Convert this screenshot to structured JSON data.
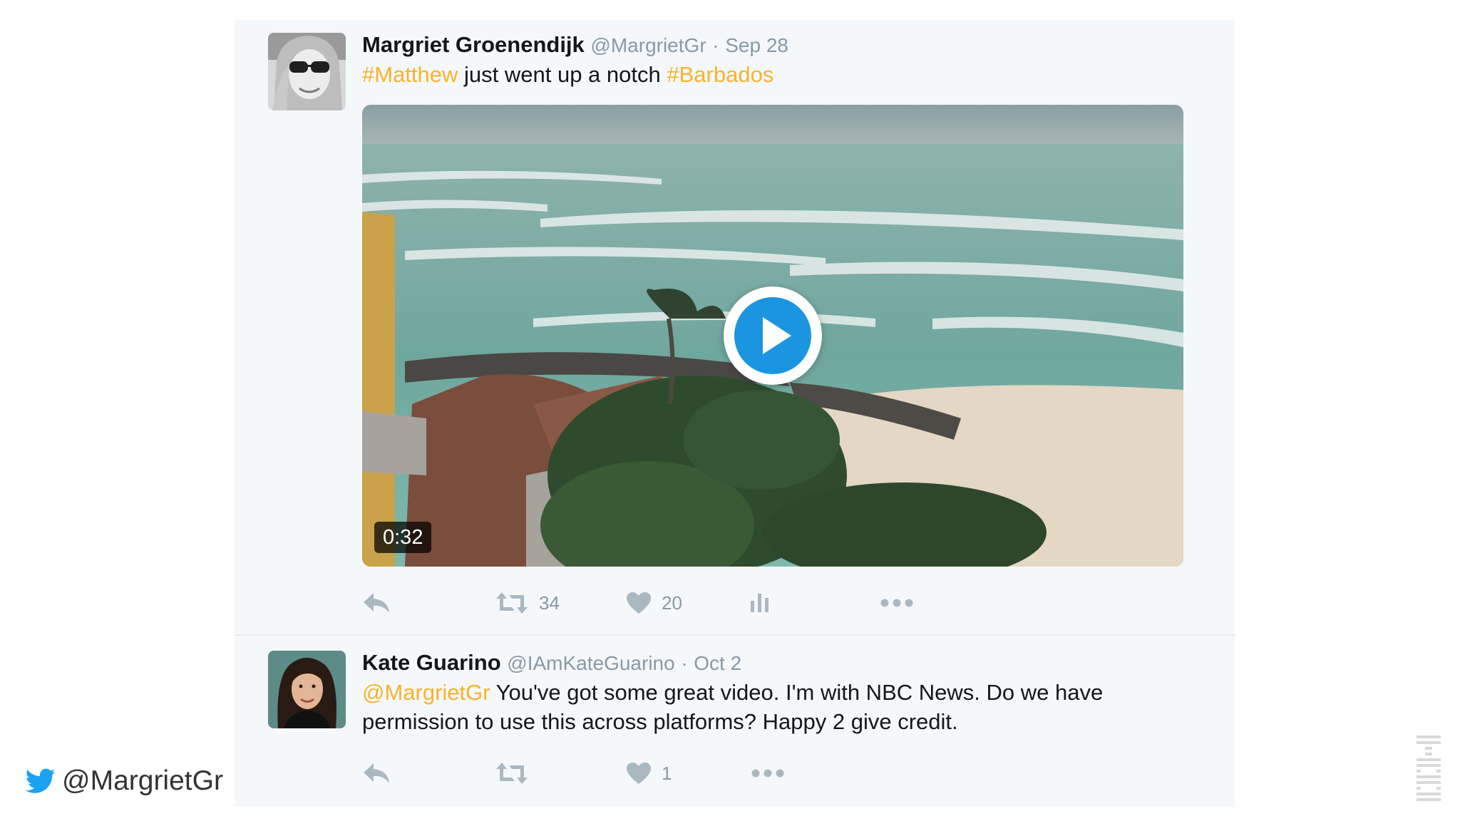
{
  "tweets": [
    {
      "name": "Margriet Groenendijk",
      "handle": "@MargrietGr",
      "date": "Sep 28",
      "text_parts": [
        {
          "text": "#Matthew",
          "highlight": true
        },
        {
          "text": " just went up a notch ",
          "highlight": false
        },
        {
          "text": "#Barbados",
          "highlight": true
        }
      ],
      "video_duration": "0:32",
      "retweets": "34",
      "likes": "20"
    },
    {
      "name": "Kate Guarino",
      "handle": "@IAmKateGuarino",
      "date": "Oct 2",
      "text_parts": [
        {
          "text": "@MargrietGr",
          "highlight": true
        },
        {
          "text": " You've got some great video. I'm with NBC News. Do we have permission to use this across platforms? Happy 2 give credit.",
          "highlight": false
        }
      ],
      "likes": "1"
    }
  ],
  "footer": {
    "handle": "@MargrietGr"
  },
  "colors": {
    "hashtag": "#f7b32b",
    "twitter_blue": "#1da1f2",
    "play_blue": "#1b95e0",
    "action_gray": "#aab8c2",
    "panel_bg": "#f5f8fa"
  },
  "icons": {
    "footer": "twitter-bird-icon",
    "reply": "reply-icon",
    "retweet": "retweet-icon",
    "like": "heart-icon",
    "analytics": "analytics-icon",
    "more": "more-icon",
    "play": "play-icon",
    "brand": "ibm-logo"
  }
}
